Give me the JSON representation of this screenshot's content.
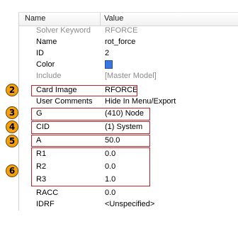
{
  "header": {
    "name_label": "Name",
    "value_label": "Value"
  },
  "rows": [
    {
      "name": "Solver Keyword",
      "value": "RFORCE",
      "disabled": true
    },
    {
      "name": "Name",
      "value": "rot_force",
      "disabled": false
    },
    {
      "name": "ID",
      "value": "2",
      "disabled": false
    },
    {
      "name": "Color",
      "value": "",
      "swatch_color": "#3a76e0",
      "disabled": false
    },
    {
      "name": "Include",
      "value": "[Master Model]",
      "disabled": true
    },
    {
      "name": "Card Image",
      "value": "RFORCE",
      "disabled": false
    },
    {
      "name": "User Comments",
      "value": "Hide In Menu/Export",
      "disabled": false
    },
    {
      "name": "G",
      "value": "(410) Node",
      "disabled": false
    },
    {
      "name": "CID",
      "value": "(1) System",
      "disabled": false
    },
    {
      "name": "A",
      "value": "50.0",
      "disabled": false
    },
    {
      "name": "R1",
      "value": "0.0",
      "disabled": false
    },
    {
      "name": "R2",
      "value": "0.0",
      "disabled": false
    },
    {
      "name": "R3",
      "value": "1.0",
      "disabled": false
    },
    {
      "name": "RACC",
      "value": "0.0",
      "disabled": false
    },
    {
      "name": "IDRF",
      "value": "<Unspecified>",
      "disabled": false
    }
  ],
  "callouts": [
    {
      "number": "2"
    },
    {
      "number": "3"
    },
    {
      "number": "4"
    },
    {
      "number": "5"
    },
    {
      "number": "6"
    }
  ],
  "colors": {
    "highlight_box": "#c0262a",
    "badge_fill": "#f5a20a",
    "disabled_text": "#8c8c8c"
  }
}
